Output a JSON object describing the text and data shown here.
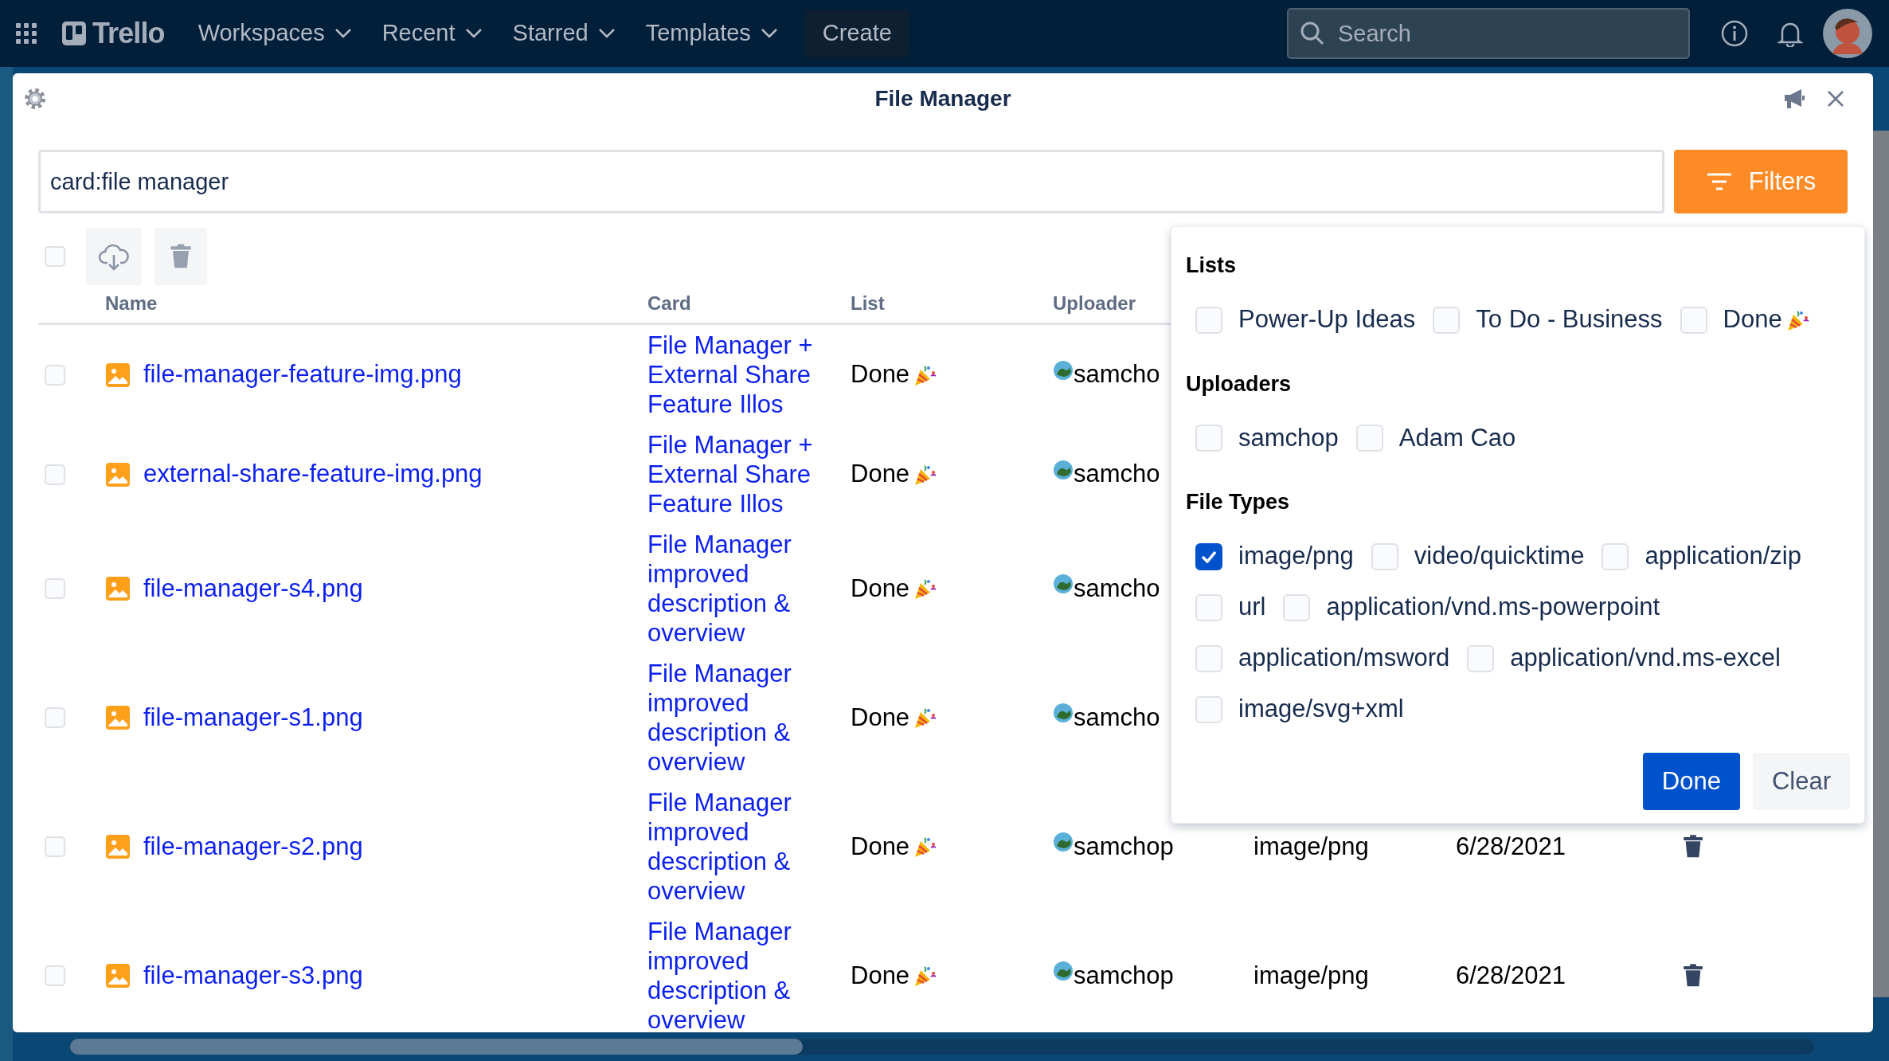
{
  "nav": {
    "brand": "Trello",
    "menus": [
      {
        "label": "Workspaces"
      },
      {
        "label": "Recent"
      },
      {
        "label": "Starred"
      },
      {
        "label": "Templates"
      }
    ],
    "create": "Create",
    "search": {
      "placeholder": "Search"
    }
  },
  "modal": {
    "title": "File Manager",
    "search": {
      "value": "card:file manager"
    },
    "filters_button": "Filters",
    "select_all": {
      "checked": false
    },
    "columns": [
      "Name",
      "Card",
      "List",
      "Uploader"
    ],
    "rows": [
      {
        "selected": false,
        "name": "file-manager-feature-img.png",
        "card": "File Manager + External Share Feature Illos",
        "list": "Done",
        "uploader": "samcho"
      },
      {
        "selected": false,
        "name": "external-share-feature-img.png",
        "card": "File Manager + External Share Feature Illos",
        "list": "Done",
        "uploader": "samcho"
      },
      {
        "selected": false,
        "name": "file-manager-s4.png",
        "card": "File Manager improved description & overview",
        "list": "Done",
        "uploader": "samcho"
      },
      {
        "selected": false,
        "name": "file-manager-s1.png",
        "card": "File Manager improved description & overview",
        "list": "Done",
        "uploader": "samcho"
      },
      {
        "selected": false,
        "name": "file-manager-s2.png",
        "card": "File Manager improved description & overview",
        "list": "Done",
        "uploader": "samchop",
        "file_type": "image/png",
        "date": "6/28/2021"
      },
      {
        "selected": false,
        "name": "file-manager-s3.png",
        "card": "File Manager improved description & overview",
        "list": "Done",
        "uploader": "samchop",
        "file_type": "image/png",
        "date": "6/28/2021"
      }
    ],
    "filter_panel": {
      "sections": [
        {
          "title": "Lists",
          "options": [
            {
              "kind": "plain",
              "label": "Power-Up Ideas",
              "checked": false
            },
            {
              "kind": "plain",
              "label": "To Do - Business",
              "checked": false
            },
            {
              "kind": "party",
              "label": "Done",
              "checked": false
            }
          ]
        },
        {
          "title": "Uploaders",
          "options": [
            {
              "kind": "plain",
              "label": "samchop",
              "checked": false
            },
            {
              "kind": "plain",
              "label": "Adam Cao",
              "checked": false
            }
          ]
        },
        {
          "title": "File Types",
          "options": [
            {
              "kind": "plain",
              "label": "image/png",
              "checked": true
            },
            {
              "kind": "plain",
              "label": "video/quicktime",
              "checked": false
            },
            {
              "kind": "plain",
              "label": "application/zip",
              "checked": false
            },
            {
              "kind": "plain",
              "label": "url",
              "checked": false
            },
            {
              "kind": "plain",
              "label": "application/vnd.ms-powerpoint",
              "checked": false
            },
            {
              "kind": "plain",
              "label": "application/msword",
              "checked": false
            },
            {
              "kind": "plain",
              "label": "application/vnd.ms-excel",
              "checked": false
            },
            {
              "kind": "plain",
              "label": "image/svg+xml",
              "checked": false
            }
          ]
        }
      ],
      "done": "Done",
      "clear": "Clear"
    }
  }
}
